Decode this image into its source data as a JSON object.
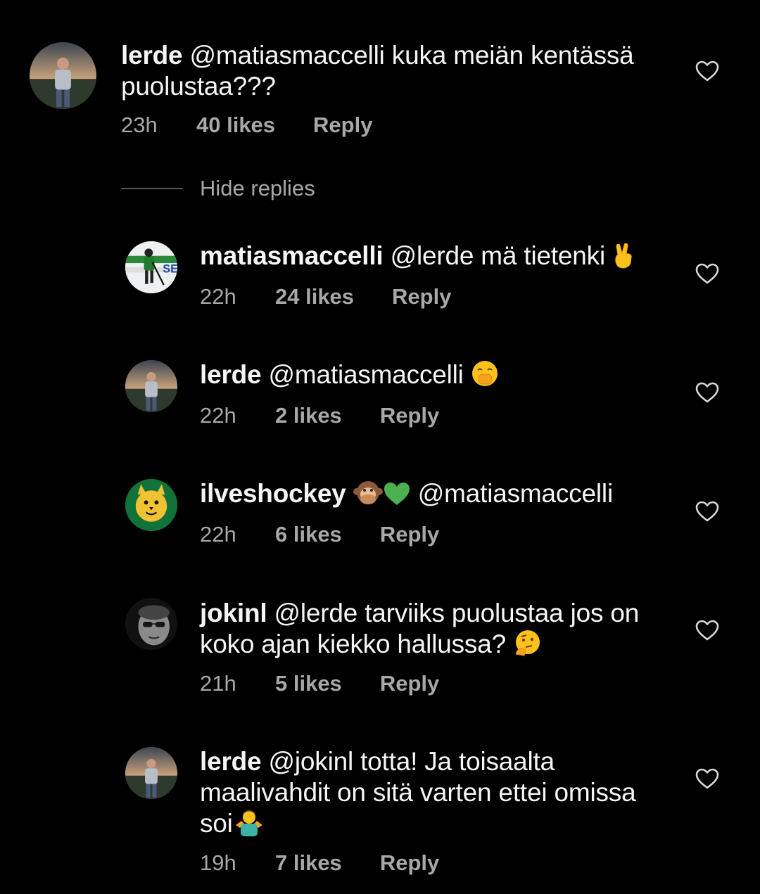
{
  "comments": [
    {
      "username": "lerde",
      "text_lines": [
        "@matiasmaccelli kuka meiän kentässä",
        "puolustaa???"
      ],
      "time": "23h",
      "likes": "40 likes",
      "reply": "Reply",
      "avatar_icon": "profile-photo-man-outdoors"
    },
    {
      "username": "matiasmaccelli",
      "text_lines": [
        "@lerde mä tietenki"
      ],
      "emoji": "crossed-fingers-emoji",
      "time": "22h",
      "likes": "24 likes",
      "reply": "Reply",
      "avatar_icon": "profile-photo-hockey-player"
    },
    {
      "username": "lerde",
      "text_lines": [
        "@matiasmaccelli"
      ],
      "emoji": "face-with-hand-over-mouth-emoji",
      "time": "22h",
      "likes": "2 likes",
      "reply": "Reply",
      "avatar_icon": "profile-photo-man-outdoors"
    },
    {
      "username": "ilveshockey",
      "text_lines": [
        "@matiasmaccelli"
      ],
      "emoji": "speak-no-evil-monkey-and-green-heart-emoji",
      "time": "22h",
      "likes": "6 likes",
      "reply": "Reply",
      "avatar_icon": "ilves-lynx-logo"
    },
    {
      "username": "jokinl",
      "text_lines": [
        "@lerde tarviiks puolustaa jos on",
        "koko ajan kiekko hallussa?"
      ],
      "emoji": "thinking-face-emoji",
      "time": "21h",
      "likes": "5 likes",
      "reply": "Reply",
      "avatar_icon": "profile-photo-man-sunglasses"
    },
    {
      "username": "lerde",
      "text_lines": [
        "@jokinl totta! Ja toisaalta",
        "maalivahdit on sitä varten ettei omissa",
        "soi"
      ],
      "emoji": "person-shrugging-emoji",
      "time": "19h",
      "likes": "7 likes",
      "reply": "Reply",
      "avatar_icon": "profile-photo-man-outdoors"
    }
  ],
  "hide_replies": "Hide replies",
  "heart_icon": "heart-outline-icon",
  "colors": {
    "background": "#000000",
    "text": "#f5f5f5",
    "secondary": "#a8a8a8",
    "mention": "#e0f1ff"
  }
}
